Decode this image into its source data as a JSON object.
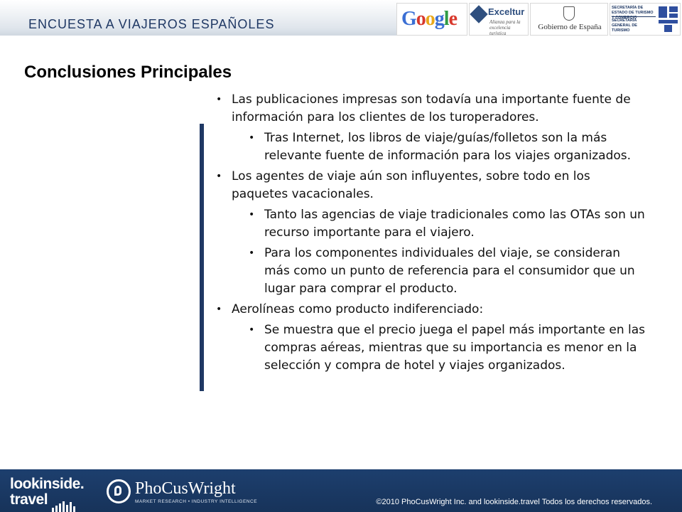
{
  "header": {
    "title": "ENCUESTA  A  VIAJEROS ESPAÑOLES",
    "logos": {
      "google": "Google",
      "exceltur_name": "Exceltur",
      "exceltur_tagline": "Alianza para la excelencia turística",
      "gobierno": "Gobierno de España",
      "secretaria_estado": "SECRETARÍA DE ESTADO DE TURISMO Y COMERCIO",
      "secretaria_general": "SECRETARÍA GENERAL DE TURISMO"
    }
  },
  "page_title": "Conclusiones Principales",
  "bullets": [
    {
      "text": "Las publicaciones impresas son todavía una importante fuente de información para los clientes de los turoperadores.",
      "sub": [
        "Tras Internet, los libros de viaje/guías/folletos son la más relevante fuente de información para los viajes organizados."
      ]
    },
    {
      "text": "Los agentes de viaje aún son influyentes, sobre todo en los paquetes vacacionales.",
      "sub": [
        "Tanto las agencias de viaje tradicionales como las OTAs son un recurso importante para el viajero.",
        "Para los componentes individuales del viaje, se consideran más como un punto de referencia para el consumidor que un lugar para comprar el producto."
      ]
    },
    {
      "text": "Aerolíneas como producto indiferenciado:",
      "sub": [
        "Se muestra que el precio juega el papel más importante en las compras aéreas, mientras que su importancia es menor en la selección y compra de hotel y viajes organizados."
      ]
    }
  ],
  "footer": {
    "lookinside_top": "lookinside.",
    "lookinside_bottom": "travel",
    "phocuswright": "PhoCusWright",
    "phocuswright_tagline": "MARKET RESEARCH • INDUSTRY INTELLIGENCE",
    "copyright": "©2010 PhoCusWright Inc. and lookinside.travel Todos los derechos reservados."
  },
  "colors": {
    "navy": "#1f3864",
    "footer_bg": "#1d3f6e"
  }
}
